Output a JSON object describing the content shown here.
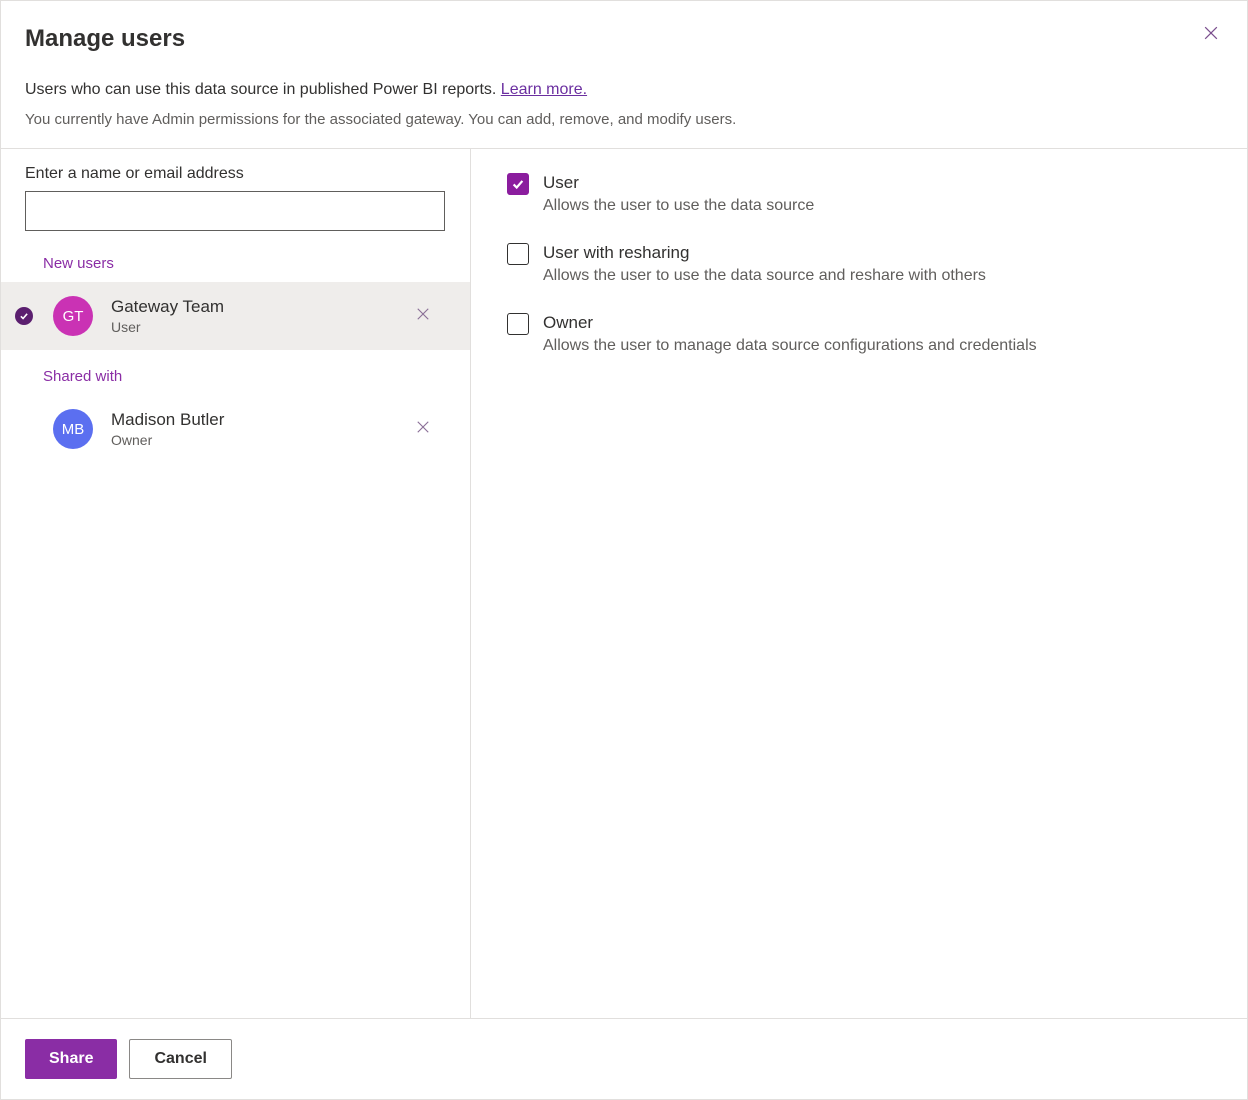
{
  "dialog": {
    "title": "Manage users",
    "subtitle_text": "Users who can use this data source in published Power BI reports. ",
    "subtitle_link": "Learn more.",
    "permissions_note": "You currently have Admin permissions for the associated gateway. You can add, remove, and modify users."
  },
  "left": {
    "input_label": "Enter a name or email address",
    "input_value": "",
    "sections": {
      "new_users_label": "New users",
      "shared_with_label": "Shared with"
    },
    "new_users": [
      {
        "initials": "GT",
        "name": "Gateway Team",
        "role": "User",
        "avatar_color": "magenta",
        "selected": true
      }
    ],
    "shared_with": [
      {
        "initials": "MB",
        "name": "Madison Butler",
        "role": "Owner",
        "avatar_color": "blue",
        "selected": false
      }
    ]
  },
  "permissions": [
    {
      "title": "User",
      "desc": "Allows the user to use the data source",
      "checked": true
    },
    {
      "title": "User with resharing",
      "desc": "Allows the user to use the data source and reshare with others",
      "checked": false
    },
    {
      "title": "Owner",
      "desc": "Allows the user to manage data source configurations and credentials",
      "checked": false
    }
  ],
  "footer": {
    "primary": "Share",
    "secondary": "Cancel"
  }
}
